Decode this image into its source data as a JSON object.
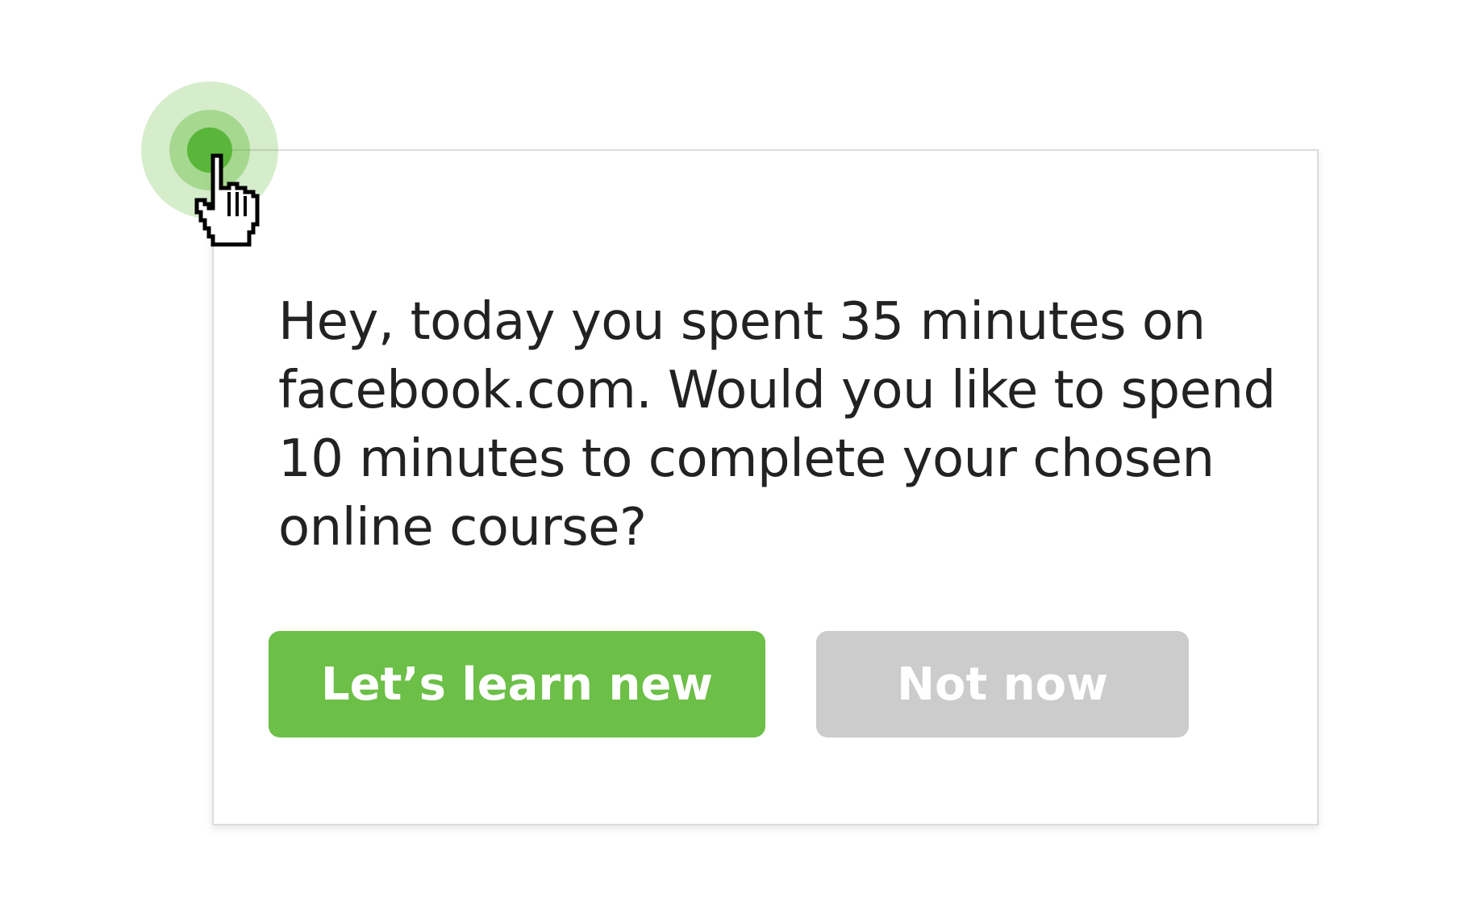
{
  "popup": {
    "message": "Hey, today you spent 35 minutes on facebook.com. Would you like to spend 10 minutes to complete your chosen online course?",
    "primary_button_label": "Let’s learn new",
    "secondary_button_label": "Not now"
  },
  "colors": {
    "accent": "#6cbf47",
    "secondary_button": "#cccccc",
    "text": "#222222"
  },
  "icons": {
    "cursor": "hand-pointer-icon",
    "indicator": "click-pulse-icon"
  }
}
